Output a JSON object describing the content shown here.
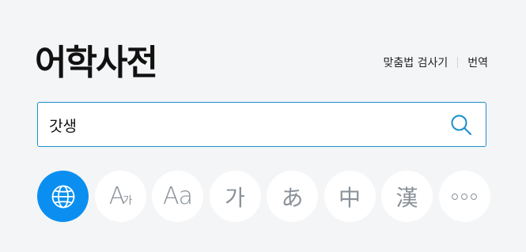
{
  "header": {
    "title": "어학사전",
    "links": [
      {
        "label": "맞춤법 검사기"
      },
      {
        "label": "번역"
      }
    ]
  },
  "search": {
    "value": "갓생"
  },
  "dictionary_buttons": [
    {
      "icon": "globe-icon",
      "label": "",
      "active": true
    },
    {
      "icon": "korean-english-icon",
      "label": "A",
      "sub": "가"
    },
    {
      "icon": "english-icon",
      "label": "Aa"
    },
    {
      "icon": "korean-icon",
      "label": "가"
    },
    {
      "icon": "japanese-icon",
      "label": "あ"
    },
    {
      "icon": "chinese-icon",
      "label": "中"
    },
    {
      "icon": "hanja-icon",
      "label": "漢"
    },
    {
      "icon": "more-icon",
      "label": ""
    }
  ],
  "colors": {
    "accent": "#0a8ff0",
    "border": "#1a8fc9",
    "background": "#f4f5f7",
    "icon_gray": "#8a9199"
  }
}
